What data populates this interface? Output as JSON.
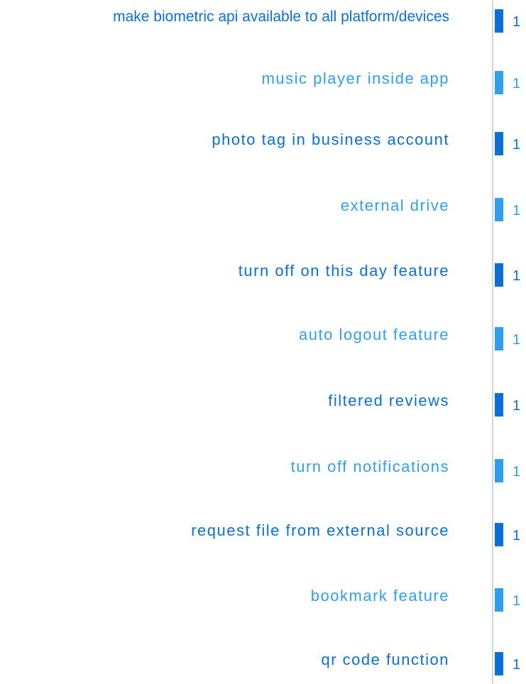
{
  "chart_data": {
    "type": "bar",
    "orientation": "horizontal",
    "categories": [
      "make biometric api available to all platform/devices",
      "music player inside app",
      "photo tag in business account",
      "external drive",
      "turn off on this day feature",
      "auto logout feature",
      "filtered reviews",
      "turn off notifications",
      "request file from external source",
      "bookmark feature",
      "qr code function"
    ],
    "values": [
      1,
      1,
      1,
      1,
      1,
      1,
      1,
      1,
      1,
      1,
      1
    ],
    "value_labels": [
      "1",
      "1",
      "1",
      "1",
      "1",
      "1",
      "1",
      "1",
      "1",
      "1",
      "1"
    ],
    "colors": [
      "#0a6fd6",
      "#2fa0ef"
    ],
    "grid": false,
    "legend": "none"
  }
}
